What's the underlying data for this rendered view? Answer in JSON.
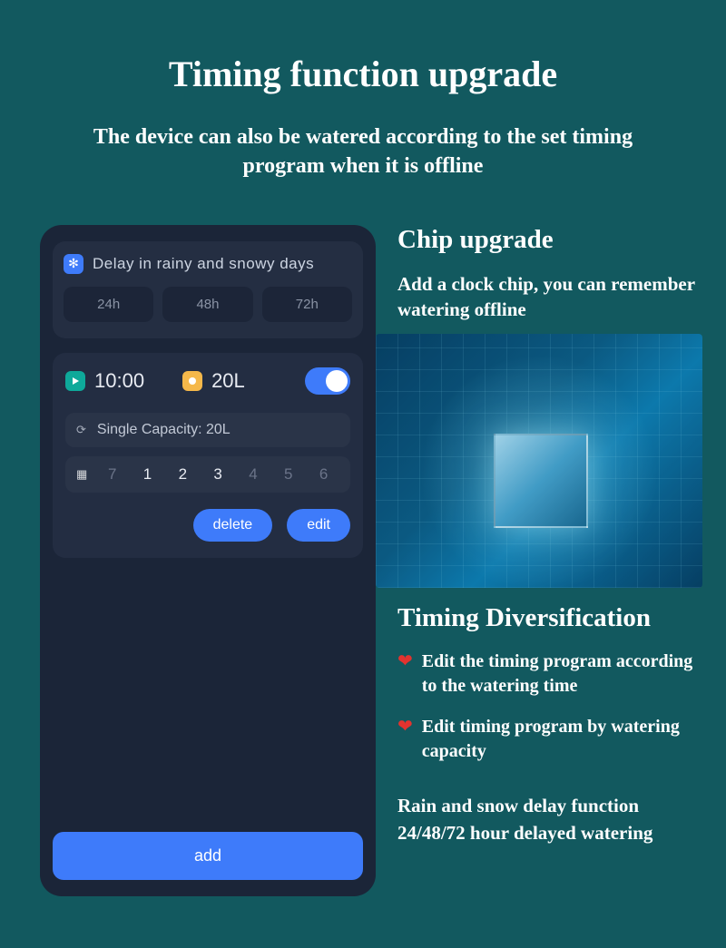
{
  "page": {
    "title": "Timing function upgrade",
    "subtitle": "The device can also be watered according to the set timing program when it is offline"
  },
  "phone": {
    "delay": {
      "title": "Delay in rainy and snowy days",
      "options": [
        "24h",
        "48h",
        "72h"
      ]
    },
    "schedule": {
      "time": "10:00",
      "liters": "20L",
      "capacity_label": "Single Capacity: 20L",
      "days": [
        {
          "n": "7",
          "active": false
        },
        {
          "n": "1",
          "active": true
        },
        {
          "n": "2",
          "active": true
        },
        {
          "n": "3",
          "active": true
        },
        {
          "n": "4",
          "active": false
        },
        {
          "n": "5",
          "active": false
        },
        {
          "n": "6",
          "active": false
        }
      ],
      "delete_label": "delete",
      "edit_label": "edit"
    },
    "add_label": "add"
  },
  "right": {
    "chip": {
      "title": "Chip upgrade",
      "body": "Add a clock chip, you can remember watering offline"
    },
    "timing": {
      "title": "Timing Diversification",
      "bullet1": "Edit the timing program according to the watering time",
      "bullet2": "Edit timing program by watering capacity"
    },
    "footer": "Rain and snow delay function 24/48/72 hour delayed watering"
  }
}
